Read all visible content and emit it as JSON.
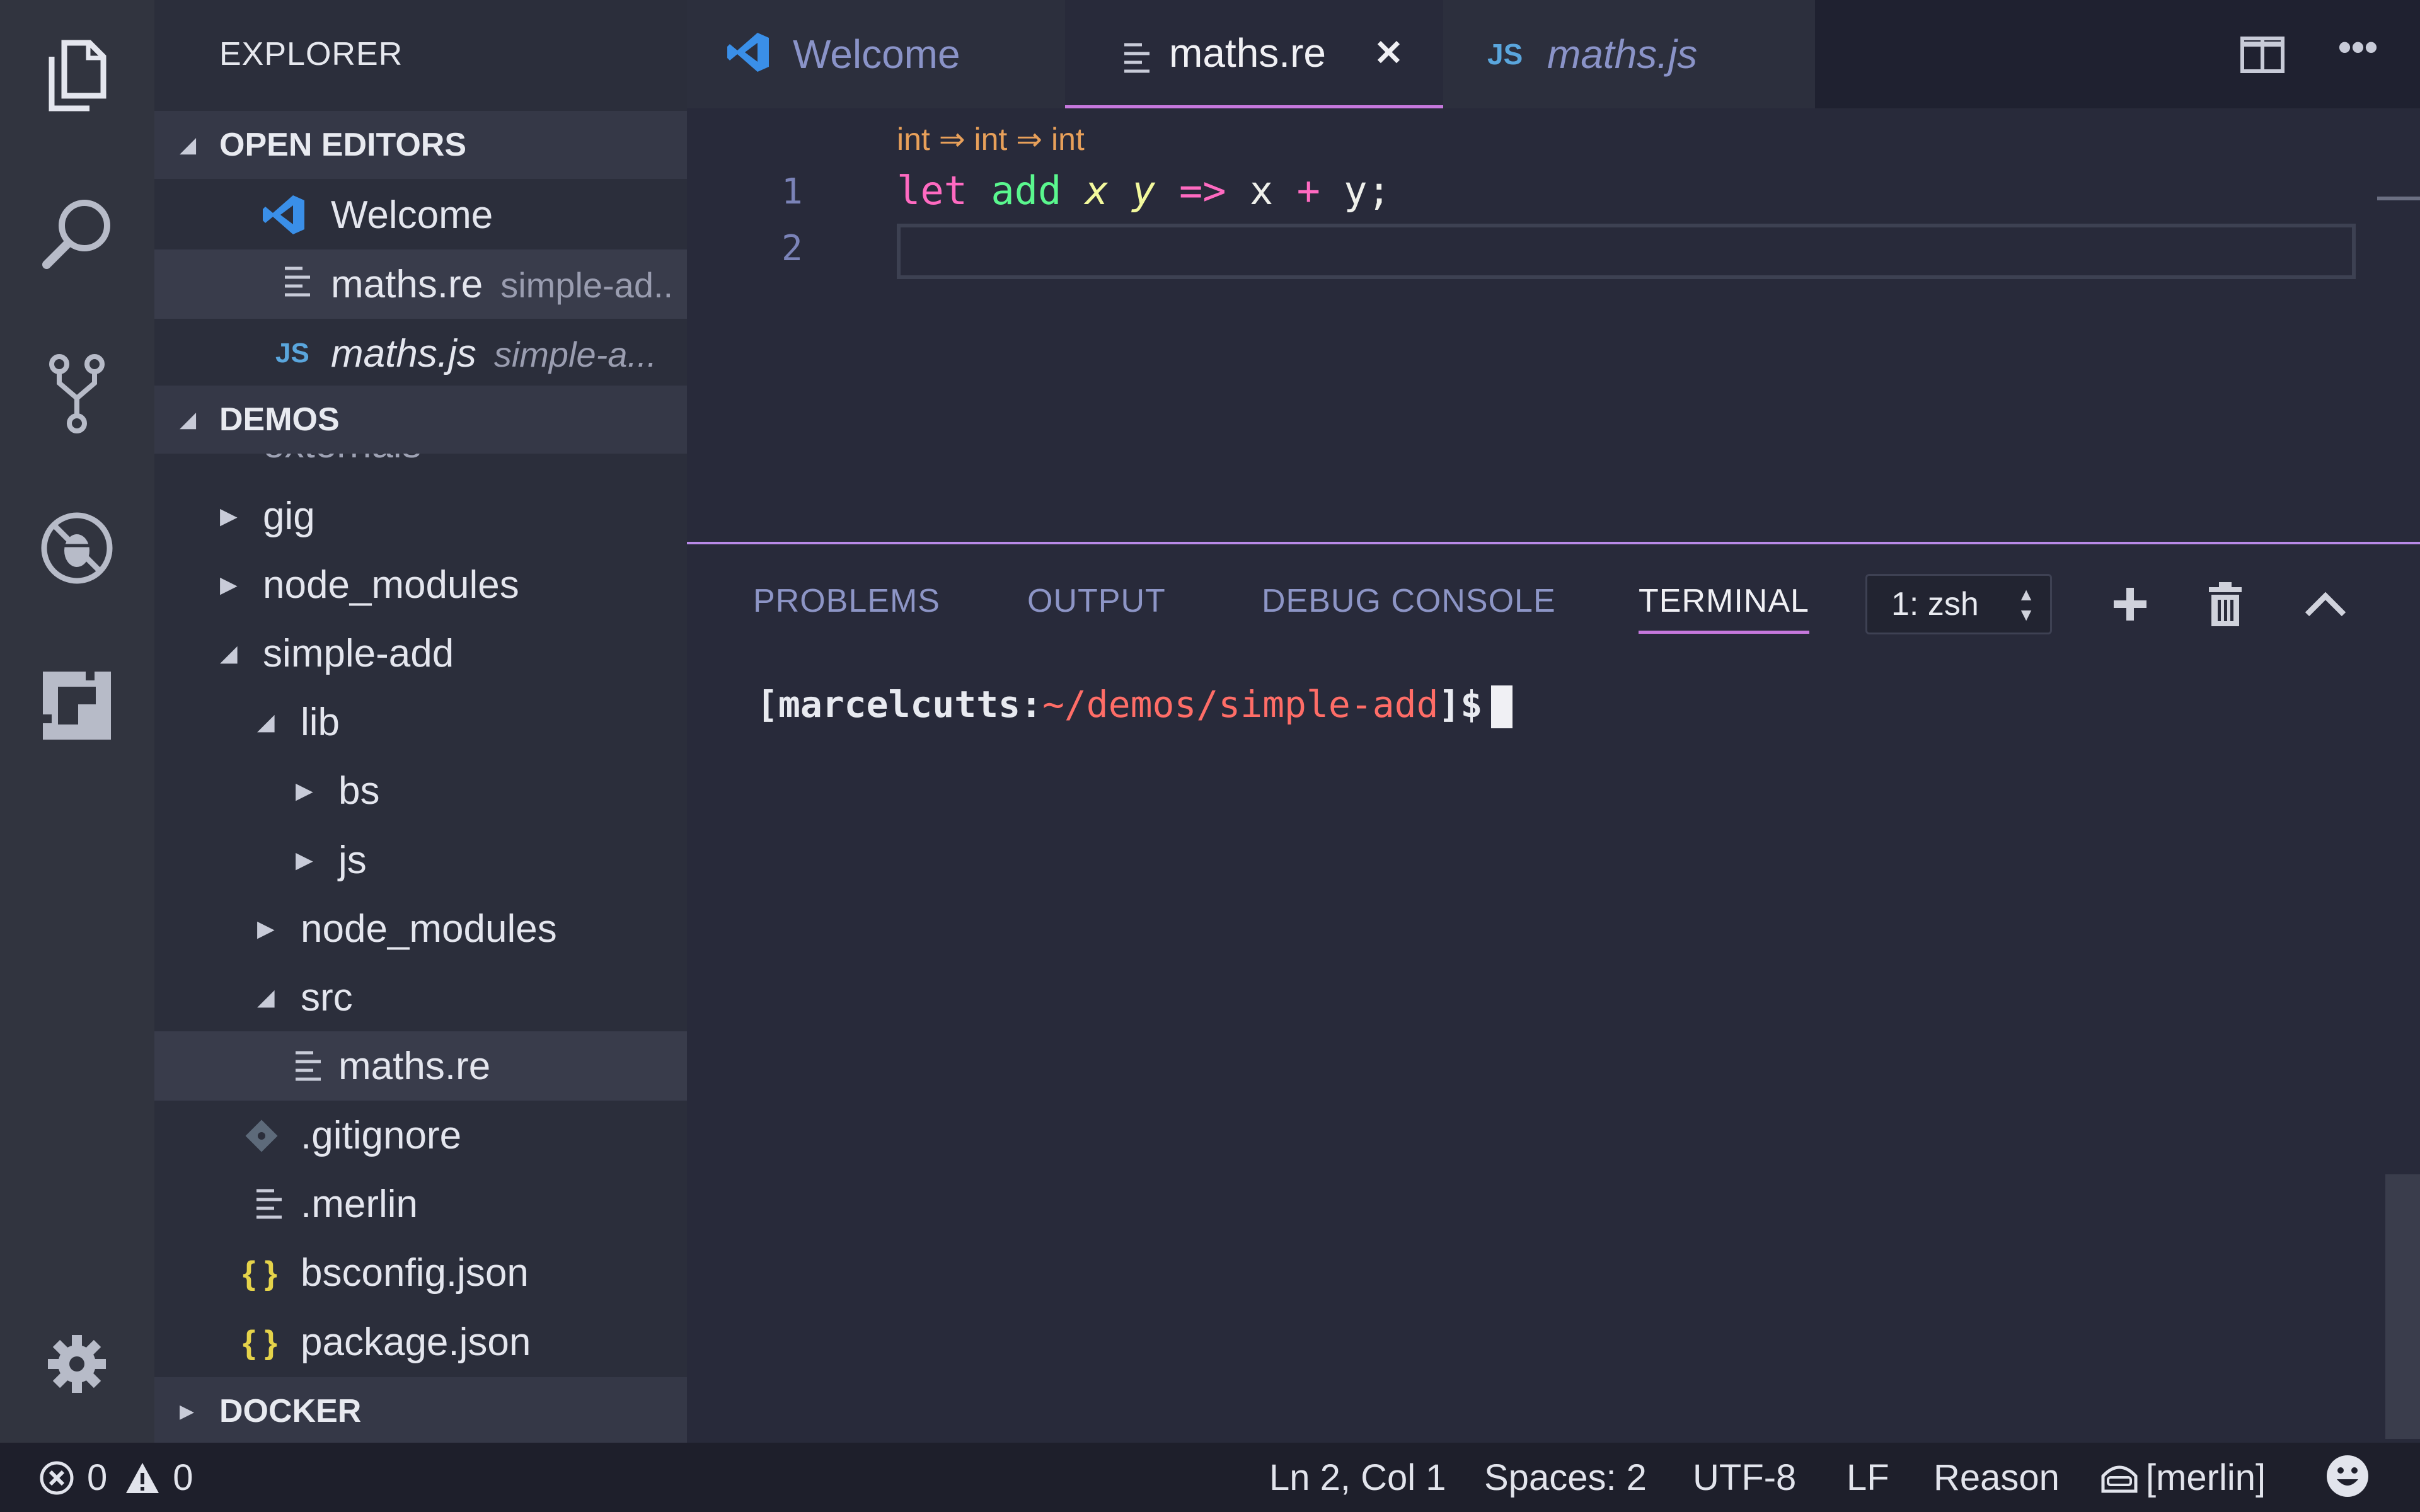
{
  "window": {
    "title": "maths.re"
  },
  "activity_bar": {
    "icons": [
      "files-icon",
      "search-icon",
      "source-control-icon",
      "debug-icon",
      "extensions-icon",
      "gear-icon"
    ]
  },
  "explorer": {
    "title": "EXPLORER",
    "open_editors": {
      "header": "OPEN EDITORS",
      "items": [
        {
          "name": "Welcome",
          "hint": ""
        },
        {
          "name": "maths.re",
          "hint": "simple-ad.."
        },
        {
          "name": "maths.js",
          "hint": "simple-a..."
        }
      ]
    },
    "demos": {
      "header": "DEMOS",
      "clipped": "externals",
      "items": [
        {
          "name": "gig"
        },
        {
          "name": "node_modules"
        },
        {
          "name": "simple-add"
        },
        {
          "name": "lib"
        },
        {
          "name": "bs"
        },
        {
          "name": "js"
        },
        {
          "name": "node_modules"
        },
        {
          "name": "src"
        },
        {
          "name": "maths.re"
        },
        {
          "name": ".gitignore"
        },
        {
          "name": ".merlin"
        },
        {
          "name": "bsconfig.json"
        },
        {
          "name": "package.json"
        }
      ]
    },
    "docker": {
      "header": "DOCKER"
    }
  },
  "tabs": [
    {
      "label": "Welcome"
    },
    {
      "label": "maths.re",
      "close": "✕"
    },
    {
      "label": "maths.js"
    }
  ],
  "editor": {
    "codelens": "int ⇒ int ⇒ int",
    "line_numbers": [
      "1",
      "2"
    ],
    "line1": {
      "kw": "let",
      "fn": "add",
      "p1": "x",
      "p2": "y",
      "arrow": "=>",
      "a": "x",
      "plus": "+",
      "b": "y",
      "semi": ";"
    }
  },
  "panel": {
    "tabs": [
      "PROBLEMS",
      "OUTPUT",
      "DEBUG CONSOLE",
      "TERMINAL"
    ],
    "active_tab": "TERMINAL",
    "terminal_select": "1: zsh",
    "prompt": {
      "open": "[",
      "user": "marcelcutts",
      "colon": ":",
      "path": "~/demos/simple-add",
      "close": "]$"
    }
  },
  "status_bar": {
    "errors": "0",
    "warnings": "0",
    "position": "Ln 2, Col 1",
    "spaces": "Spaces: 2",
    "encoding": "UTF-8",
    "eol": "LF",
    "language": "Reason",
    "merlin": "[merlin]"
  },
  "colors": {
    "accent": "#c678dd",
    "keyword": "#ff6ac1",
    "function": "#5af78e",
    "param": "#f3f99d",
    "path": "#ff6d67"
  }
}
